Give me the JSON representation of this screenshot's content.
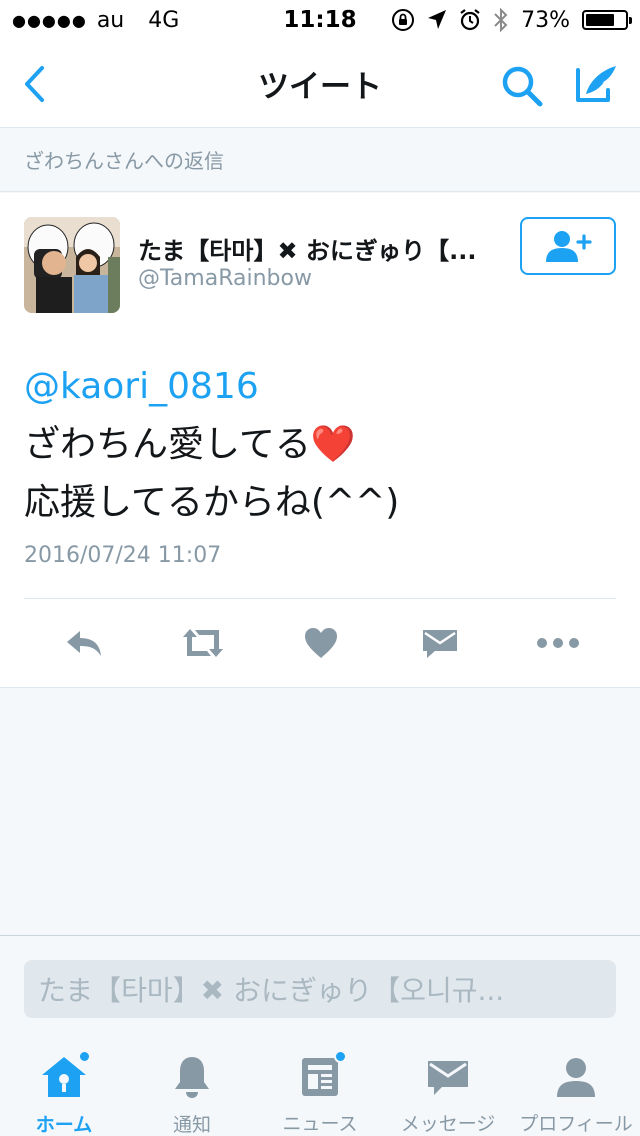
{
  "status_bar": {
    "signal": "●●●●●",
    "carrier": "au",
    "network": "4G",
    "time": "11:18",
    "battery_percent": "73%",
    "battery_level": 0.73
  },
  "nav": {
    "title": "ツイート",
    "back_icon": "chevron-left-icon",
    "search_icon": "search-icon",
    "compose_icon": "compose-icon"
  },
  "context": {
    "text": "ざわちんさんへの返信"
  },
  "tweet": {
    "author_name": "たま【타마】✖ おにぎゅり【...",
    "author_handle": "@TamaRainbow",
    "mention": "@kaori_0816",
    "line1": "ざわちん愛してる",
    "heart": "❤️",
    "line2": "応援してるからね(^^)",
    "date": "2016/07/24 11:07"
  },
  "reply": {
    "placeholder": "たま【타마】✖ おにぎゅり【오니규..."
  },
  "tabs": [
    {
      "label": "ホーム",
      "icon": "home-icon",
      "active": true,
      "badge": true
    },
    {
      "label": "通知",
      "icon": "bell-icon",
      "active": false,
      "badge": false
    },
    {
      "label": "ニュース",
      "icon": "news-icon",
      "active": false,
      "badge": true
    },
    {
      "label": "メッセージ",
      "icon": "envelope-icon",
      "active": false,
      "badge": false
    },
    {
      "label": "プロフィール",
      "icon": "profile-icon",
      "active": false,
      "badge": false
    }
  ],
  "colors": {
    "accent": "#1da1f2",
    "muted": "#8899a6",
    "text": "#14171a",
    "background": "#f5f8fa"
  }
}
